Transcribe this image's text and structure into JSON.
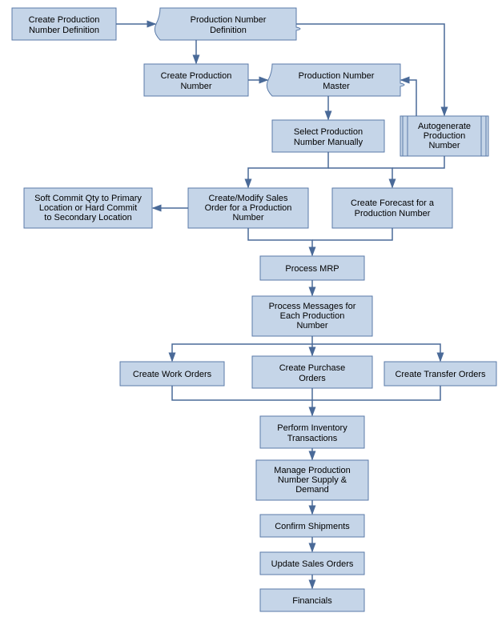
{
  "nodes": {
    "create_prod_num_def": "Create Production\nNumber Definition",
    "prod_num_def": "Production Number\nDefinition",
    "create_prod_num": "Create Production\nNumber",
    "prod_num_master": "Production Number\nMaster",
    "select_manual": "Select Production\nNumber Manually",
    "autogen": "Autogenerate\nProduction\nNumber",
    "soft_commit": "Soft Commit Qty to Primary\nLocation or Hard Commit\nto Secondary Location",
    "create_sales": "Create/Modify Sales\nOrder for a Production\nNumber",
    "create_forecast": "Create Forecast for a\nProduction Number",
    "process_mrp": "Process MRP",
    "process_msgs": "Process Messages for\nEach Production\nNumber",
    "create_work": "Create Work Orders",
    "create_purchase": "Create Purchase\nOrders",
    "create_transfer": "Create Transfer Orders",
    "perform_inv": "Perform Inventory\nTransactions",
    "manage_supply": "Manage Production\nNumber Supply &\nDemand",
    "confirm_ship": "Confirm Shipments",
    "update_sales": "Update Sales Orders",
    "financials": "Financials"
  }
}
